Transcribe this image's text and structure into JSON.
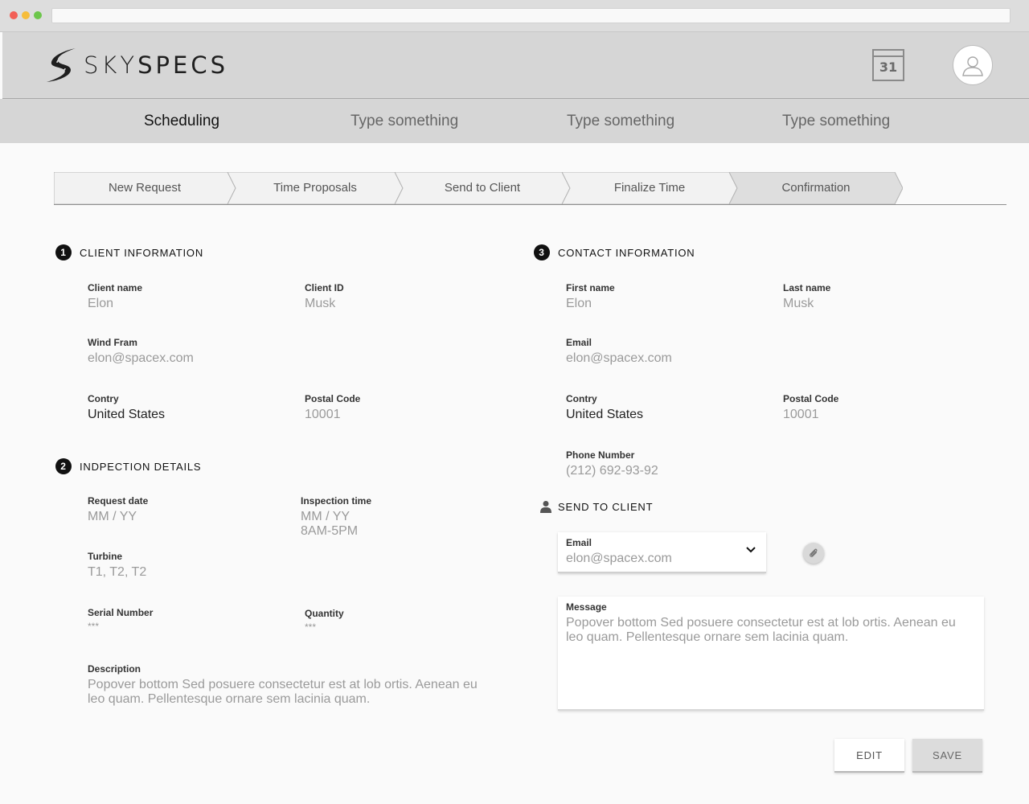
{
  "brand": {
    "logo_text_light": "SKY",
    "logo_text_bold": "SPECS"
  },
  "header": {
    "calendar_day": "31"
  },
  "nav": {
    "items": [
      {
        "label": "Scheduling",
        "active": true
      },
      {
        "label": "Type something",
        "active": false
      },
      {
        "label": "Type something",
        "active": false
      },
      {
        "label": "Type something",
        "active": false
      }
    ]
  },
  "stepper": {
    "steps": [
      "New Request",
      "Time Proposals",
      "Send to Client",
      "Finalize Time",
      "Confirmation"
    ],
    "active_step": "Confirmation"
  },
  "client_info": {
    "number": "1",
    "title": "CLIENT INFORMATION",
    "client_name": {
      "label": "Client name",
      "value": "Elon"
    },
    "client_id": {
      "label": "Client ID",
      "value": "Musk"
    },
    "wind_farm": {
      "label": "Wind Fram",
      "value": "elon@spacex.com"
    },
    "country": {
      "label": "Contry",
      "value": "United States"
    },
    "postal_code": {
      "label": "Postal Code",
      "value": "10001"
    }
  },
  "inspection": {
    "number": "2",
    "title": "INDPECTION DETAILS",
    "request_date": {
      "label": "Request date",
      "value": "MM / YY"
    },
    "inspection_time": {
      "label": "Inspection time",
      "value_date": "MM / YY",
      "value_time": "8AM-5PM"
    },
    "turbine": {
      "label": "Turbine",
      "value": "T1, T2, T2"
    },
    "serial_number": {
      "label": "Serial Number",
      "value": "***"
    },
    "quantity": {
      "label": "Quantity",
      "value": "***"
    },
    "description": {
      "label": "Description",
      "value": "Popover bottom Sed posuere consectetur est at lob ortis. Aenean eu leo quam. Pellentesque ornare sem lacinia quam."
    }
  },
  "contact_info": {
    "number": "3",
    "title": "CONTACT INFORMATION",
    "first_name": {
      "label": "First name",
      "value": "Elon"
    },
    "last_name": {
      "label": "Last name",
      "value": "Musk"
    },
    "email": {
      "label": "Email",
      "value": "elon@spacex.com"
    },
    "country": {
      "label": "Contry",
      "value": "United States"
    },
    "postal_code": {
      "label": "Postal Code",
      "value": "10001"
    },
    "phone": {
      "label": "Phone Number",
      "value": "(212) 692-93-92"
    }
  },
  "send_to_client": {
    "title": "SEND TO CLIENT",
    "email": {
      "label": "Email",
      "value": "elon@spacex.com"
    },
    "message": {
      "label": "Message",
      "value": "Popover bottom Sed posuere consectetur est at lob ortis. Aenean eu leo quam. Pellentesque ornare sem lacinia quam."
    }
  },
  "actions": {
    "edit_label": "EDIT",
    "save_label": "SAVE"
  },
  "colors": {
    "header_bg": "#d6d6d6",
    "page_bg": "#fafafa",
    "muted_text": "#9a9a9a"
  },
  "icons": [
    "calendar-icon",
    "user-avatar-icon",
    "chevron-down-icon",
    "paperclip-icon",
    "person-icon"
  ]
}
